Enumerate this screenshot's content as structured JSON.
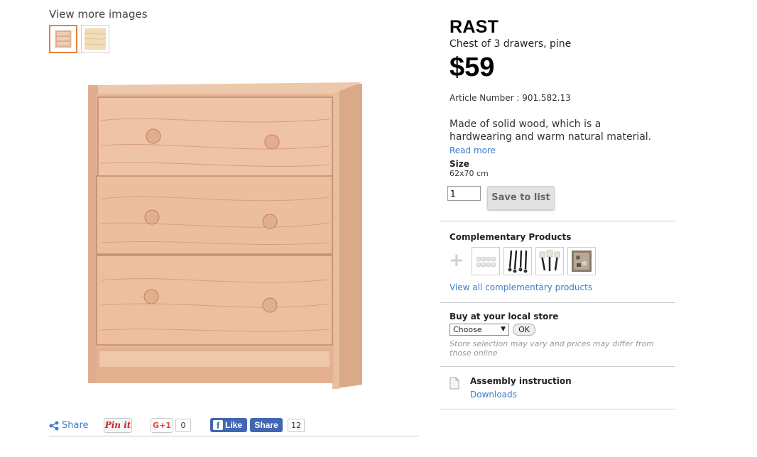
{
  "gallery": {
    "view_more_label": "View more images"
  },
  "share": {
    "share_label": "Share",
    "pinit_label": "Pin it",
    "gplus_label": "G+1",
    "gplus_count": "0",
    "fb_like_label": "Like",
    "fb_share_label": "Share",
    "fb_count": "12"
  },
  "product": {
    "name": "RAST",
    "subtitle": "Chest of 3 drawers, pine",
    "price": "$59",
    "article_number": "Article Number : 901.582.13",
    "description": "Made of solid wood, which is a hardwearing and warm natural material.",
    "read_more": "Read more",
    "size_label": "Size",
    "size_value": "62x70 cm",
    "quantity": "1",
    "save_label": "Save to list"
  },
  "complementary": {
    "title": "Complementary Products",
    "view_all": "View all complementary products"
  },
  "store": {
    "title": "Buy at your local store",
    "select_value": "Choose",
    "ok_label": "OK",
    "note": "Store selection may vary and prices may differ from those online"
  },
  "assembly": {
    "title": "Assembly instruction",
    "downloads": "Downloads"
  },
  "colors": {
    "link": "#3d7cc9",
    "selected_thumb_border": "#e8823c",
    "facebook": "#4267b2",
    "pinterest": "#cb2027",
    "wood": "#e3b89a"
  }
}
